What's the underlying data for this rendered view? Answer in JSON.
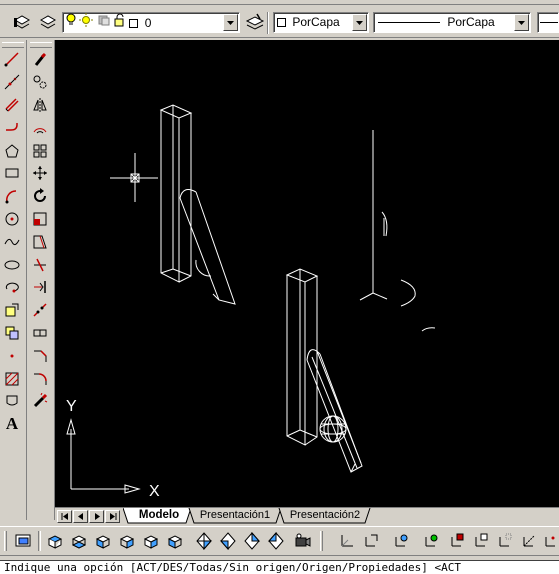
{
  "layer_toolbar": {
    "layer_name": "0",
    "color_value": "PorCapa",
    "linetype_value": "PorCapa"
  },
  "layout_tabs": {
    "active": "Modelo",
    "tabs": [
      "Modelo",
      "Presentación1",
      "Presentación2"
    ]
  },
  "ucs": {
    "x_label": "X",
    "y_label": "Y"
  },
  "command_line": {
    "text": "Indique una opción [ACT/DES/Todas/Sin origen/Origen/Propiedades] <ACT"
  },
  "icons": {
    "left_toolbar_1": [
      "line-icon",
      "construction-line-icon",
      "multiline-icon",
      "polyline-icon",
      "polygon-icon",
      "rectangle-icon",
      "arc-icon",
      "circle-icon",
      "spline-icon",
      "ellipse-icon",
      "ellipse-arc-icon",
      "insert-block-icon",
      "make-block-icon",
      "point-icon",
      "hatch-icon",
      "region-icon",
      "text-icon"
    ],
    "left_toolbar_2": [
      "erase-icon",
      "copy-icon",
      "mirror-icon",
      "offset-icon",
      "array-icon",
      "move-icon",
      "rotate-icon",
      "scale-icon",
      "stretch-icon",
      "trim-icon",
      "extend-icon",
      "break-icon",
      "join-icon",
      "chamfer-icon",
      "fillet-icon",
      "explode-icon"
    ]
  },
  "colors": {
    "canvas": "#000000",
    "drawing_lines": "#ffffff",
    "chrome": "#d4d0c8"
  }
}
